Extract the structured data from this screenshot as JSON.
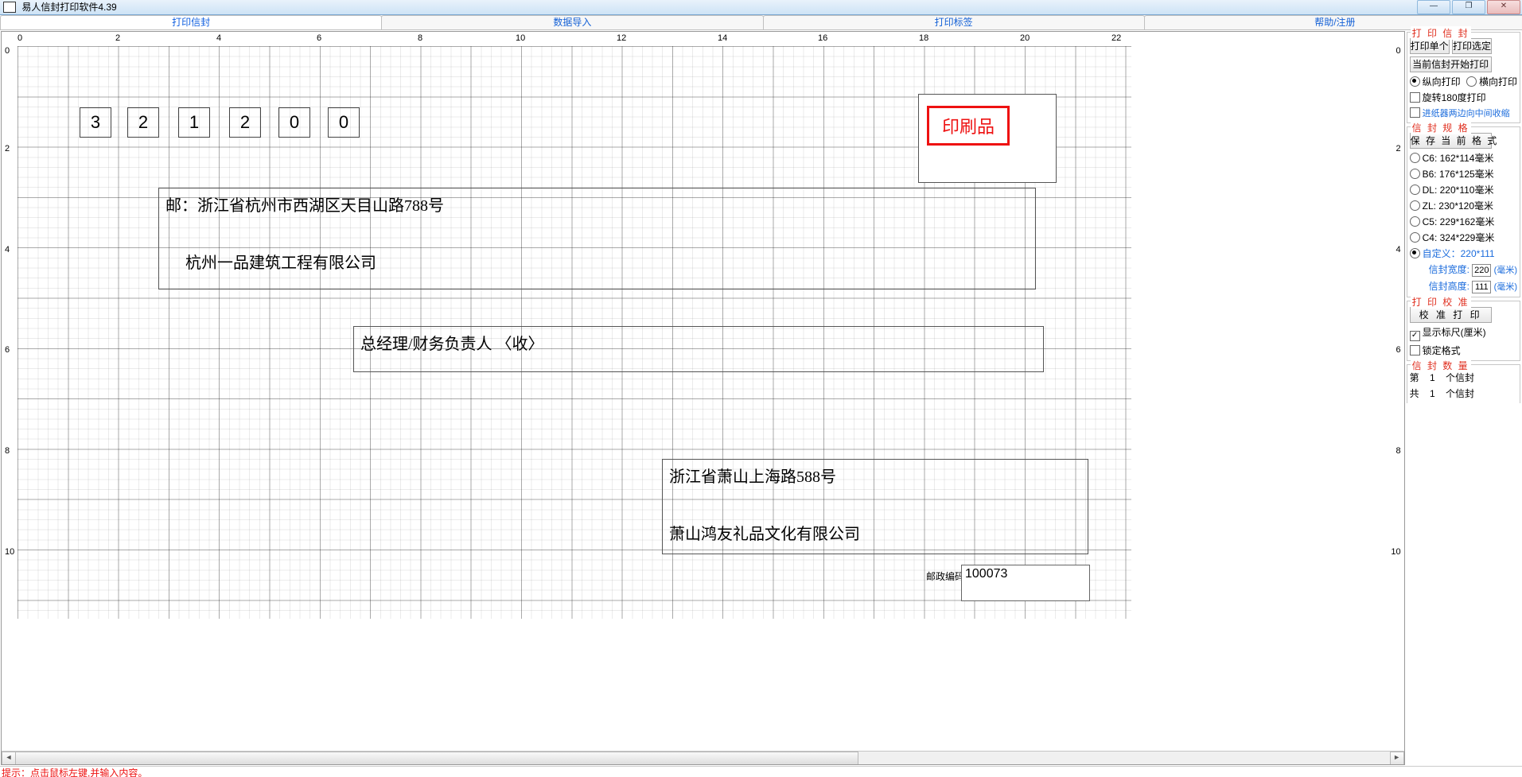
{
  "window": {
    "title": "易人信封打印软件4.39"
  },
  "win_buttons": {
    "min": "—",
    "max": "❐",
    "close": "✕"
  },
  "tabs": [
    "打印信封",
    "数据导入",
    "打印标签",
    "帮助/注册"
  ],
  "ruler": {
    "h": [
      "0",
      "2",
      "4",
      "6",
      "8",
      "10",
      "12",
      "14",
      "16",
      "18",
      "20",
      "22"
    ],
    "v": [
      "0",
      "2",
      "4",
      "6",
      "8",
      "10"
    ]
  },
  "envelope": {
    "postcode_digits": [
      "3",
      "2",
      "1",
      "2",
      "0",
      "0"
    ],
    "stamp_text": "印刷品",
    "recipient_block": "邮：浙江省杭州市西湖区天目山路788号\n\n     杭州一品建筑工程有限公司",
    "attn_block": "总经理/财务负责人 〈收〉",
    "sender_block": "浙江省萧山上海路588号\n\n萧山鸿友礼品文化有限公司",
    "sender_pc_label": "邮政编码",
    "sender_pc_value": "100073"
  },
  "panel_print": {
    "legend": "打 印 信 封",
    "btn_single": "打印单个",
    "btn_selected": "打印选定",
    "btn_from_current": "当前信封开始打印",
    "radio_portrait": "纵向打印",
    "radio_landscape": "横向打印",
    "chk_rotate": "旋转180度打印",
    "chk_feed": "进纸器两边向中间收缩"
  },
  "panel_spec": {
    "legend": "信 封 规 格",
    "btn_save": "保 存 当 前 格 式",
    "sizes": [
      "C6: 162*114毫米",
      "B6: 176*125毫米",
      "DL: 220*110毫米",
      "ZL: 230*120毫米",
      "C5: 229*162毫米",
      "C4: 324*229毫米"
    ],
    "custom_label": "自定义：220*111",
    "width_label": "信封宽度:",
    "width_value": "220",
    "width_unit": "(毫米)",
    "height_label": "信封高度:",
    "height_value": "111",
    "height_unit": "(毫米)"
  },
  "panel_cal": {
    "legend": "打 印 校 准",
    "btn_cal": "校 准 打 印",
    "chk_ruler": "显示标尺(厘米)",
    "chk_lock": "锁定格式"
  },
  "panel_count": {
    "legend": "信 封 数 量",
    "line1_a": "第",
    "line1_b": "1",
    "line1_c": "个信封",
    "line2_a": "共",
    "line2_b": "1",
    "line2_c": "个信封"
  },
  "status": "提示：点击鼠标左键,并输入内容。"
}
